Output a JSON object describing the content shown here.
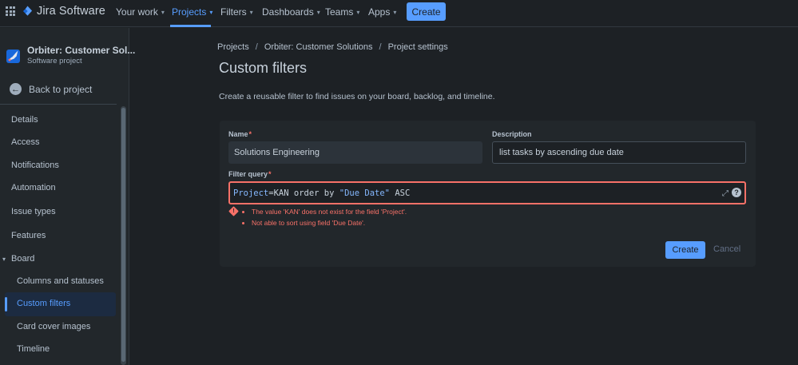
{
  "topnav": {
    "product": "Jira Software",
    "items": [
      {
        "label": "Your work"
      },
      {
        "label": "Projects"
      },
      {
        "label": "Filters"
      },
      {
        "label": "Dashboards"
      },
      {
        "label": "Teams"
      },
      {
        "label": "Apps"
      }
    ],
    "create_label": "Create"
  },
  "sidebar": {
    "project_name": "Orbiter: Customer Sol...",
    "project_type": "Software project",
    "back_label": "Back to project",
    "items": [
      {
        "label": "Details"
      },
      {
        "label": "Access"
      },
      {
        "label": "Notifications"
      },
      {
        "label": "Automation"
      },
      {
        "label": "Issue types"
      },
      {
        "label": "Features"
      },
      {
        "label": "Board"
      }
    ],
    "board_items": [
      {
        "label": "Columns and statuses"
      },
      {
        "label": "Custom filters"
      },
      {
        "label": "Card cover images"
      },
      {
        "label": "Timeline"
      }
    ]
  },
  "breadcrumb": [
    "Projects",
    "Orbiter: Customer Solutions",
    "Project settings"
  ],
  "page": {
    "title": "Custom filters",
    "description": "Create a reusable filter to find issues on your board, backlog, and timeline."
  },
  "form": {
    "name_label": "Name",
    "name_value": "Solutions Engineering",
    "description_label": "Description",
    "description_value": "list tasks by ascending due date",
    "query_label": "Filter query",
    "query": {
      "key": "Project",
      "eq": "=KAN order by ",
      "str": "\"Due Date\"",
      "tail": " ASC"
    },
    "required_mark": "*",
    "errors": [
      "The value 'KAN' does not exist for the field 'Project'.",
      "Not able to sort using field 'Due Date'."
    ],
    "create_label": "Create",
    "cancel_label": "Cancel"
  },
  "colors": {
    "accent": "#579dff",
    "error": "#f87168",
    "background": "#1d2125"
  }
}
